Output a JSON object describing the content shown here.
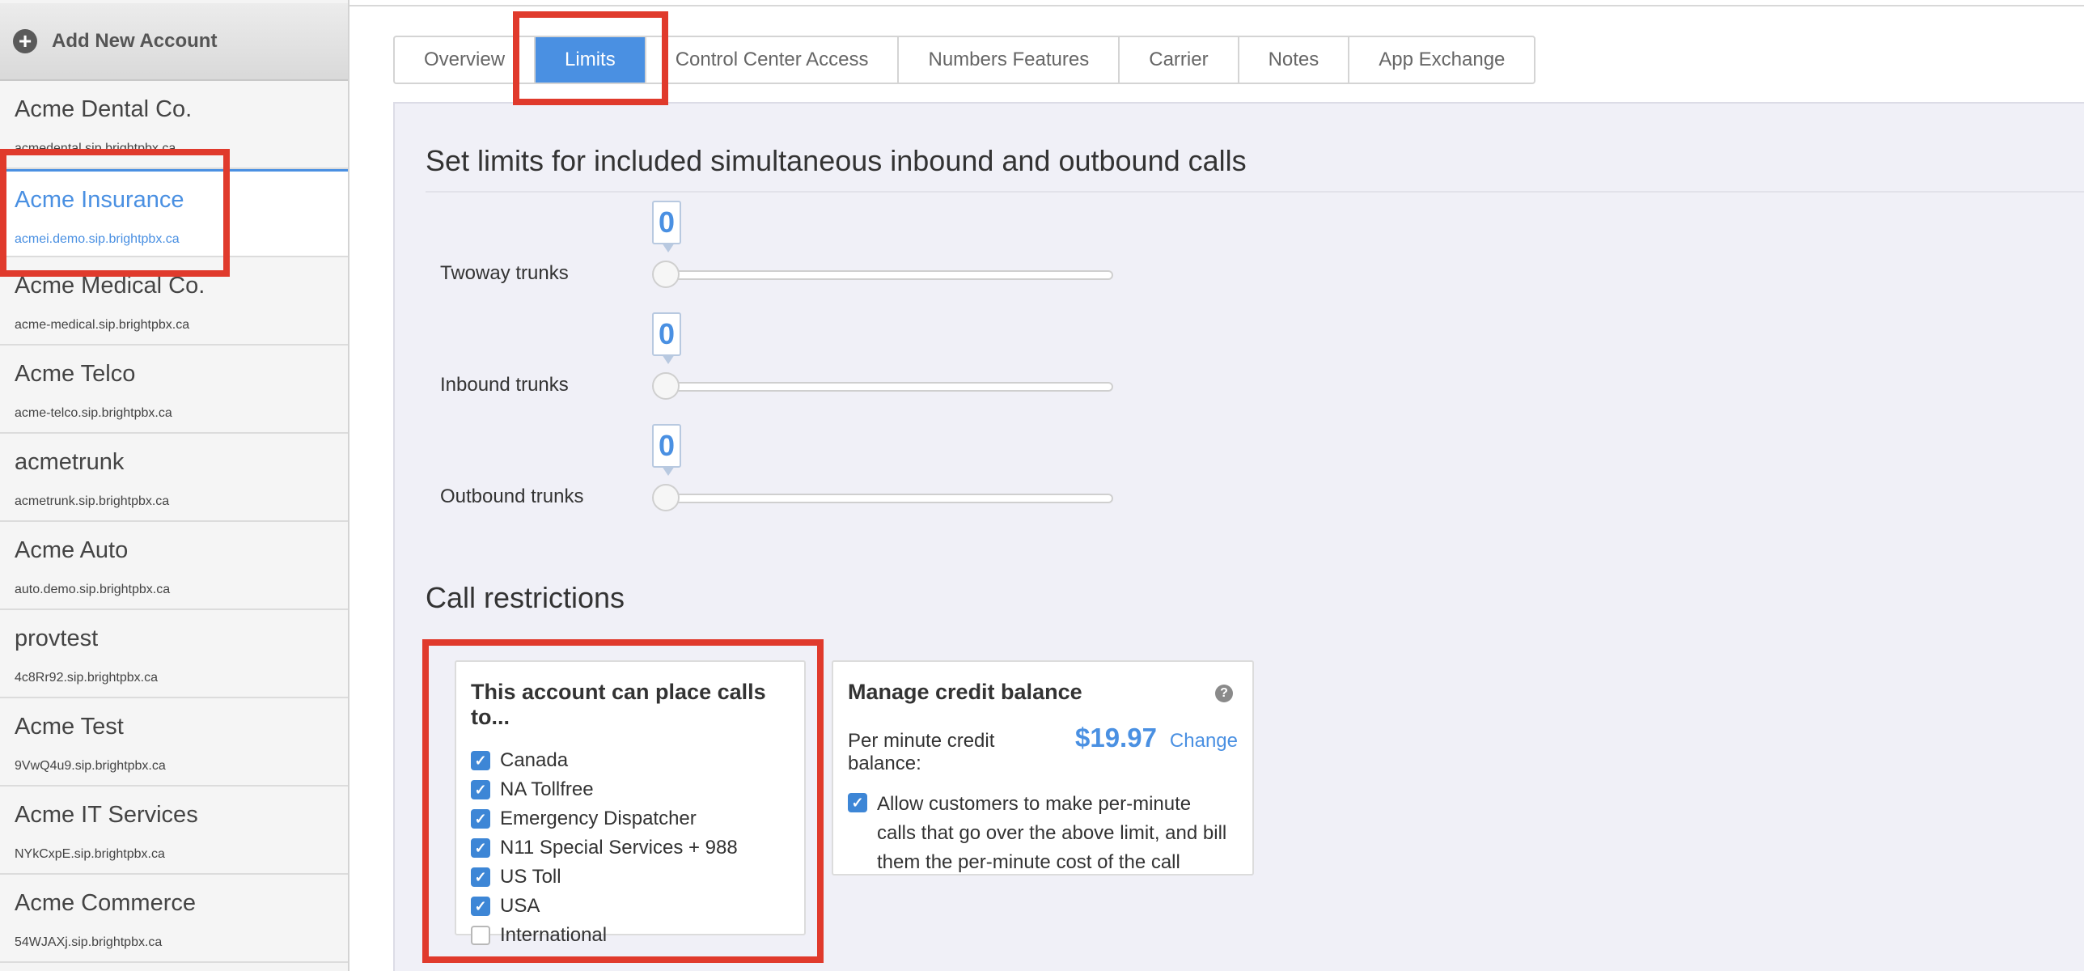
{
  "sidebar": {
    "add_account_label": "Add New Account",
    "accounts": [
      {
        "name": "Acme Dental Co.",
        "host": "acmedental.sip.brightpbx.ca"
      },
      {
        "name": "Acme Insurance",
        "host": "acmei.demo.sip.brightpbx.ca",
        "active": true
      },
      {
        "name": "Acme Medical Co.",
        "host": "acme-medical.sip.brightpbx.ca"
      },
      {
        "name": "Acme Telco",
        "host": "acme-telco.sip.brightpbx.ca"
      },
      {
        "name": "acmetrunk",
        "host": "acmetrunk.sip.brightpbx.ca"
      },
      {
        "name": "Acme Auto",
        "host": "auto.demo.sip.brightpbx.ca"
      },
      {
        "name": "provtest",
        "host": "4c8Rr92.sip.brightpbx.ca"
      },
      {
        "name": "Acme Test",
        "host": "9VwQ4u9.sip.brightpbx.ca"
      },
      {
        "name": "Acme IT Services",
        "host": "NYkCxpE.sip.brightpbx.ca"
      },
      {
        "name": "Acme Commerce",
        "host": "54WJAXj.sip.brightpbx.ca"
      }
    ]
  },
  "tabs": [
    {
      "label": "Overview"
    },
    {
      "label": "Limits",
      "active": true
    },
    {
      "label": "Control Center Access"
    },
    {
      "label": "Numbers Features"
    },
    {
      "label": "Carrier"
    },
    {
      "label": "Notes"
    },
    {
      "label": "App Exchange"
    }
  ],
  "limits": {
    "title": "Set limits for included simultaneous inbound and outbound calls",
    "sliders": [
      {
        "label": "Twoway trunks",
        "value": "0"
      },
      {
        "label": "Inbound trunks",
        "value": "0"
      },
      {
        "label": "Outbound trunks",
        "value": "0"
      }
    ]
  },
  "restrictions": {
    "title": "Call restrictions",
    "card_title": "This account can place calls to...",
    "options": [
      {
        "label": "Canada",
        "checked": true
      },
      {
        "label": "NA Tollfree",
        "checked": true
      },
      {
        "label": "Emergency Dispatcher",
        "checked": true
      },
      {
        "label": "N11 Special Services + 988",
        "checked": true
      },
      {
        "label": "US Toll",
        "checked": true
      },
      {
        "label": "USA",
        "checked": true
      },
      {
        "label": "International",
        "checked": false
      }
    ]
  },
  "credit": {
    "title": "Manage credit balance",
    "balance_label": "Per minute credit balance:",
    "balance_value": "$19.97",
    "change_label": "Change",
    "allow_label": "Allow customers to make per-minute calls that go over the above limit, and bill them the per-minute cost of the call",
    "allow_checked": true
  },
  "colors": {
    "accent": "#4a90e2",
    "annotation": "#e03a2c"
  }
}
